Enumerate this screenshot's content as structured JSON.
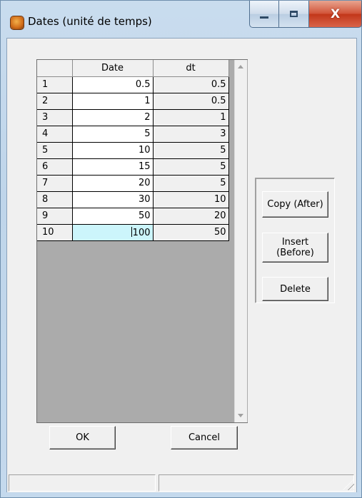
{
  "window": {
    "title": "Dates (unité de temps)",
    "icon": "app-icon",
    "controls": {
      "minimize": "minimize-icon",
      "maximize": "maximize-icon",
      "close_label": "X"
    }
  },
  "grid": {
    "columns": [
      "",
      "Date",
      "dt"
    ],
    "rows": [
      {
        "index": "1",
        "date": "0.5",
        "dt": "0.5"
      },
      {
        "index": "2",
        "date": "1",
        "dt": "0.5"
      },
      {
        "index": "3",
        "date": "2",
        "dt": "1"
      },
      {
        "index": "4",
        "date": "5",
        "dt": "3"
      },
      {
        "index": "5",
        "date": "10",
        "dt": "5"
      },
      {
        "index": "6",
        "date": "15",
        "dt": "5"
      },
      {
        "index": "7",
        "date": "20",
        "dt": "5"
      },
      {
        "index": "8",
        "date": "30",
        "dt": "10"
      },
      {
        "index": "9",
        "date": "50",
        "dt": "20"
      },
      {
        "index": "10",
        "date": "100",
        "dt": "50"
      }
    ],
    "active_row": 10,
    "active_cell_color": "#ccf5fb"
  },
  "side_buttons": {
    "copy": "Copy (After)",
    "insert": "Insert\n(Before)",
    "delete": "Delete"
  },
  "footer": {
    "ok": "OK",
    "cancel": "Cancel"
  }
}
